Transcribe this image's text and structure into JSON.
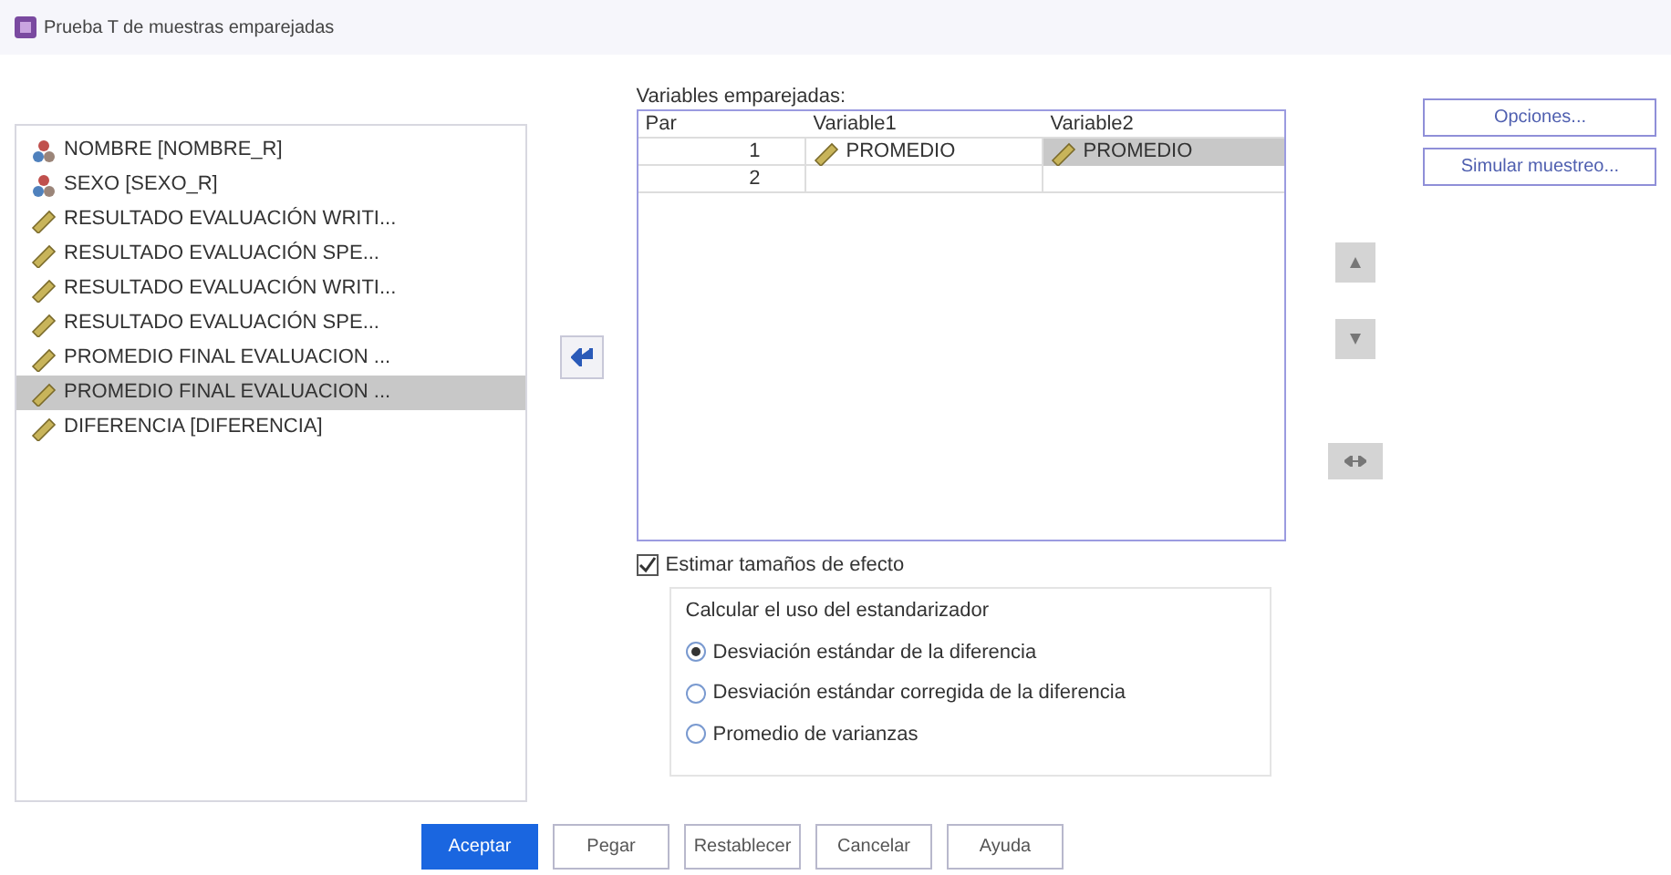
{
  "window": {
    "title": "Prueba T de muestras emparejadas"
  },
  "variables": [
    {
      "label": "NOMBRE [NOMBRE_R]",
      "kind": "nominal",
      "selected": false
    },
    {
      "label": "SEXO [SEXO_R]",
      "kind": "nominal",
      "selected": false
    },
    {
      "label": "RESULTADO EVALUACIÓN WRITI...",
      "kind": "scale",
      "selected": false
    },
    {
      "label": "RESULTADO EVALUACIÓN SPE...",
      "kind": "scale",
      "selected": false
    },
    {
      "label": "RESULTADO EVALUACIÓN WRITI...",
      "kind": "scale",
      "selected": false
    },
    {
      "label": "RESULTADO EVALUACIÓN SPE...",
      "kind": "scale",
      "selected": false
    },
    {
      "label": "PROMEDIO FINAL EVALUACION ...",
      "kind": "scale",
      "selected": false
    },
    {
      "label": "PROMEDIO FINAL EVALUACION ...",
      "kind": "scale",
      "selected": true
    },
    {
      "label": "DIFERENCIA [DIFERENCIA]",
      "kind": "scale",
      "selected": false
    }
  ],
  "pairs": {
    "label": "Variables emparejadas:",
    "columns": [
      "Par",
      "Variable1",
      "Variable2"
    ],
    "rows": [
      {
        "par": "1",
        "variable1": "PROMEDIO",
        "variable2": "PROMEDIO",
        "variable2_selected": true
      },
      {
        "par": "2"
      }
    ]
  },
  "side_buttons": [
    "Opciones...",
    "Simular muestreo..."
  ],
  "effect_size": {
    "label": "Estimar tamaños de efecto",
    "checked": true
  },
  "standardizer": {
    "title": "Calcular el uso del estandarizador",
    "options": [
      {
        "label": "Desviación estándar de la diferencia",
        "selected": true
      },
      {
        "label": "Desviación estándar corregida de la diferencia",
        "selected": false
      },
      {
        "label": "Promedio de varianzas",
        "selected": false
      }
    ]
  },
  "buttons": [
    {
      "label": "Aceptar",
      "primary": true
    },
    {
      "label": "Pegar",
      "primary": false
    },
    {
      "label": "Restablecer",
      "primary": false
    },
    {
      "label": "Cancelar",
      "primary": false
    },
    {
      "label": "Ayuda",
      "primary": false
    }
  ]
}
